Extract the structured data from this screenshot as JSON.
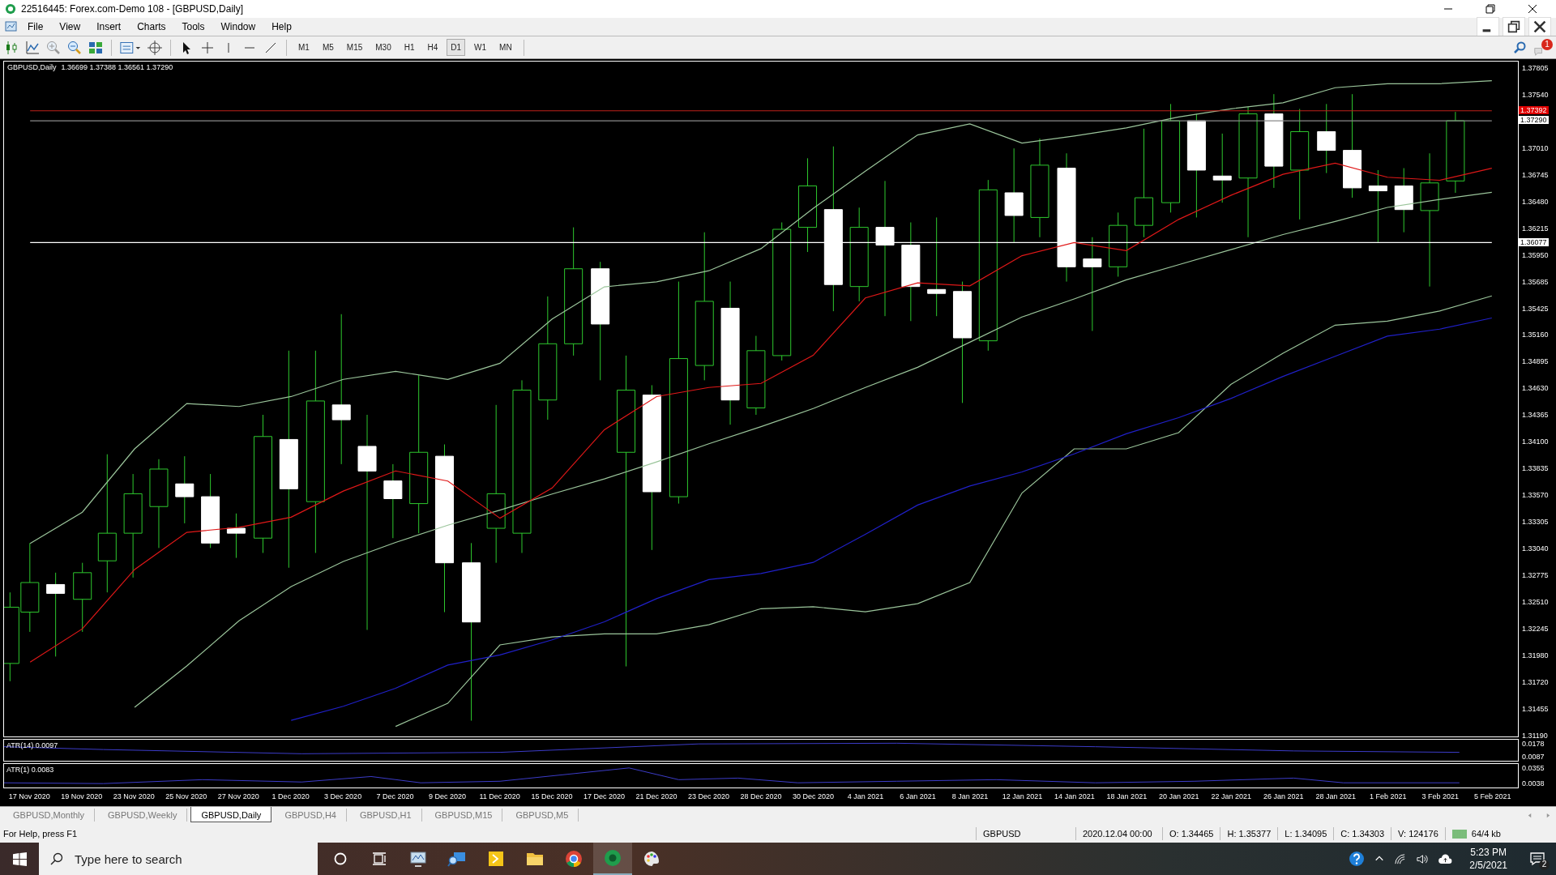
{
  "window": {
    "title": "22516445: Forex.com-Demo 108 - [GBPUSD,Daily]"
  },
  "menu": [
    "File",
    "View",
    "Insert",
    "Charts",
    "Tools",
    "Window",
    "Help"
  ],
  "toolbar": {
    "timeframes": [
      {
        "label": "M1",
        "selected": false
      },
      {
        "label": "M5",
        "selected": false
      },
      {
        "label": "M15",
        "selected": false
      },
      {
        "label": "M30",
        "selected": false
      },
      {
        "label": "H1",
        "selected": false
      },
      {
        "label": "H4",
        "selected": false
      },
      {
        "label": "D1",
        "selected": true
      },
      {
        "label": "W1",
        "selected": false
      },
      {
        "label": "MN",
        "selected": false
      }
    ],
    "alert_count": "1"
  },
  "chart": {
    "symbol": "GBPUSD,Daily",
    "ohlc": "1.36699 1.37388 1.36561 1.37290",
    "chart_data": {
      "type": "line",
      "categories": [
        "17 Nov 2020",
        "19 Nov 2020",
        "23 Nov 2020",
        "25 Nov 2020",
        "27 Nov 2020",
        "1 Dec 2020",
        "3 Dec 2020",
        "7 Dec 2020",
        "9 Dec 2020",
        "11 Dec 2020",
        "15 Dec 2020",
        "17 Dec 2020",
        "21 Dec 2020",
        "23 Dec 2020",
        "28 Dec 2020",
        "30 Dec 2020",
        "4 Jan 2021",
        "6 Jan 2021",
        "8 Jan 2021",
        "12 Jan 2021",
        "14 Jan 2021",
        "18 Jan 2021",
        "20 Jan 2021",
        "22 Jan 2021",
        "26 Jan 2021",
        "28 Jan 2021",
        "1 Feb 2021",
        "3 Feb 2021",
        "5 Feb 2021"
      ],
      "series": [
        {
          "color": "#9bc59b",
          "values": [
            1.3309,
            1.334,
            1.3403,
            1.3448,
            1.3445,
            1.3455,
            1.3472,
            1.348,
            1.3472,
            1.3488,
            1.3532,
            1.3564,
            1.3569,
            1.358,
            1.3602,
            1.3642,
            1.3679,
            1.3715,
            1.3726,
            1.3707,
            1.3714,
            1.3722,
            1.3733,
            1.3741,
            1.3747,
            1.3762,
            1.3766,
            1.3766,
            1.3769
          ]
        },
        {
          "color": "#9bc59b",
          "values": [
            null,
            null,
            1.3146,
            1.3187,
            1.3232,
            1.3266,
            1.3291,
            1.331,
            1.3327,
            1.3342,
            1.3358,
            1.3373,
            1.339,
            1.3408,
            1.3425,
            1.3443,
            1.3464,
            1.3484,
            1.3509,
            1.3534,
            1.3552,
            1.3571,
            1.3586,
            1.3601,
            1.3616,
            1.3629,
            1.3643,
            1.3651,
            1.3658
          ]
        },
        {
          "color": "#9bc59b",
          "values": [
            null,
            null,
            null,
            null,
            null,
            null,
            null,
            1.3127,
            1.315,
            1.3208,
            1.3216,
            1.3219,
            1.3219,
            1.3228,
            1.3244,
            1.3246,
            1.3241,
            1.3249,
            1.327,
            1.3359,
            1.3403,
            1.3403,
            1.3419,
            1.3467,
            1.3498,
            1.3526,
            1.353,
            1.354,
            1.3555
          ]
        },
        {
          "color": "#2020c8",
          "values": [
            null,
            null,
            null,
            null,
            null,
            1.3133,
            1.3147,
            1.3165,
            1.3188,
            1.3198,
            1.3213,
            1.3231,
            1.3254,
            1.3273,
            1.3279,
            1.329,
            1.3318,
            1.3347,
            1.3366,
            1.338,
            1.3398,
            1.3418,
            1.3434,
            1.3453,
            1.3475,
            1.3495,
            1.3515,
            1.3522,
            1.3533
          ]
        },
        {
          "color": "#c0201a",
          "values": [
            1.3739,
            1.3739,
            1.3739,
            1.3739,
            1.3739,
            1.3739,
            1.3739,
            1.3739,
            1.3739,
            1.3739,
            1.3739,
            1.3739,
            1.3739,
            1.3739,
            1.3739,
            1.3739,
            1.3739,
            1.3739,
            1.3739,
            1.3739,
            1.3739,
            1.3739,
            1.3739,
            1.3739,
            1.3739,
            1.3739,
            1.3739,
            1.3739,
            1.3739
          ]
        },
        {
          "color": "#8a8a8a",
          "values": [
            1.3729,
            1.3729,
            1.3729,
            1.3729,
            1.3729,
            1.3729,
            1.3729,
            1.3729,
            1.3729,
            1.3729,
            1.3729,
            1.3729,
            1.3729,
            1.3729,
            1.3729,
            1.3729,
            1.3729,
            1.3729,
            1.3729,
            1.3729,
            1.3729,
            1.3729,
            1.3729,
            1.3729,
            1.3729,
            1.3729,
            1.3729,
            1.3729,
            1.3729
          ]
        },
        {
          "color": "#ffffff",
          "values": [
            1.3608,
            1.3608,
            1.3608,
            1.3608,
            1.3608,
            1.3608,
            1.3608,
            1.3608,
            1.3608,
            1.3608,
            1.3608,
            1.3608,
            1.3608,
            1.3608,
            1.3608,
            1.3608,
            1.3608,
            1.3608,
            1.3608,
            1.3608,
            1.3608,
            1.3608,
            1.3608,
            1.3608,
            1.3608,
            1.3608,
            1.3608,
            1.3608,
            1.3608
          ]
        },
        {
          "color": "#e01818",
          "values": [
            1.3191,
            1.3224,
            1.3283,
            1.332,
            1.3325,
            1.3335,
            1.3361,
            1.3381,
            1.3371,
            1.3334,
            1.3364,
            1.3422,
            1.3455,
            1.3464,
            1.3468,
            1.3496,
            1.3553,
            1.3568,
            1.3565,
            1.3595,
            1.3608,
            1.36,
            1.3631,
            1.3655,
            1.3676,
            1.3687,
            1.3673,
            1.367,
            1.3682
          ]
        }
      ],
      "ylim": [
        1.3117,
        1.3788
      ],
      "yticks": [
        {
          "value": 1.37805,
          "label": "1.37805"
        },
        {
          "value": 1.3754,
          "label": "1.37540"
        },
        {
          "value": 1.3701,
          "label": "1.37010"
        },
        {
          "value": 1.36745,
          "label": "1.36745"
        },
        {
          "value": 1.3648,
          "label": "1.36480"
        },
        {
          "value": 1.36215,
          "label": "1.36215"
        },
        {
          "value": 1.3595,
          "label": "1.35950"
        },
        {
          "value": 1.35685,
          "label": "1.35685"
        },
        {
          "value": 1.35425,
          "label": "1.35425"
        },
        {
          "value": 1.3516,
          "label": "1.35160"
        },
        {
          "value": 1.34895,
          "label": "1.34895"
        },
        {
          "value": 1.3463,
          "label": "1.34630"
        },
        {
          "value": 1.34365,
          "label": "1.34365"
        },
        {
          "value": 1.341,
          "label": "1.34100"
        },
        {
          "value": 1.33835,
          "label": "1.33835"
        },
        {
          "value": 1.3357,
          "label": "1.33570"
        },
        {
          "value": 1.33305,
          "label": "1.33305"
        },
        {
          "value": 1.3304,
          "label": "1.33040"
        },
        {
          "value": 1.32775,
          "label": "1.32775"
        },
        {
          "value": 1.3251,
          "label": "1.32510"
        },
        {
          "value": 1.32245,
          "label": "1.32245"
        },
        {
          "value": 1.3198,
          "label": "1.31980"
        },
        {
          "value": 1.3172,
          "label": "1.31720"
        },
        {
          "value": 1.31455,
          "label": "1.31455"
        },
        {
          "value": 1.3119,
          "label": "1.31190"
        }
      ]
    },
    "price_tags": [
      {
        "text": "1.37392",
        "kind": "ask"
      },
      {
        "text": "1.37290",
        "kind": "bid"
      },
      {
        "text": "1.36077",
        "kind": "level"
      }
    ],
    "indicators": [
      {
        "label": "ATR(14) 0.0097",
        "scale": [
          "0.0178",
          "0.0087"
        ]
      },
      {
        "label": "ATR(1) 0.0083",
        "scale": [
          "0.0355",
          "0.0038"
        ]
      }
    ]
  },
  "chart_tabs": [
    {
      "label": "GBPUSD,Monthly",
      "selected": false
    },
    {
      "label": "GBPUSD,Weekly",
      "selected": false
    },
    {
      "label": "GBPUSD,Daily",
      "selected": true
    },
    {
      "label": "GBPUSD,H4",
      "selected": false
    },
    {
      "label": "GBPUSD,H1",
      "selected": false
    },
    {
      "label": "GBPUSD,M15",
      "selected": false
    },
    {
      "label": "GBPUSD,M5",
      "selected": false
    }
  ],
  "status_bar": {
    "help": "For Help, press F1",
    "symbol": "GBPUSD",
    "time": "2020.12.04 00:00",
    "open": "O: 1.34465",
    "high": "H: 1.35377",
    "low": "L: 1.34095",
    "close": "C: 1.34303",
    "volume": "V: 124176",
    "traffic": "64/4 kb"
  },
  "taskbar": {
    "search_placeholder": "Type here to search",
    "time": "5:23 PM",
    "date": "2/5/2021",
    "notifications": "2"
  }
}
